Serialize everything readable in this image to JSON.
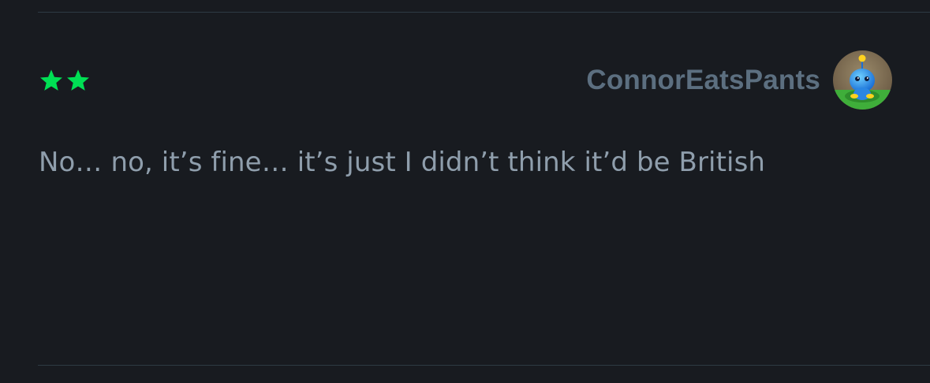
{
  "review": {
    "rating": 2,
    "rating_color": "#00e054",
    "author": "ConnorEatsPants",
    "avatar_icon": "chao-avatar-icon",
    "body": "No… no, it’s fine… it’s just I didn’t think it’d be British"
  },
  "colors": {
    "background": "#181b20",
    "divider": "#2d3a43",
    "author_text": "#5c6f80",
    "body_text": "#8f9eac"
  }
}
